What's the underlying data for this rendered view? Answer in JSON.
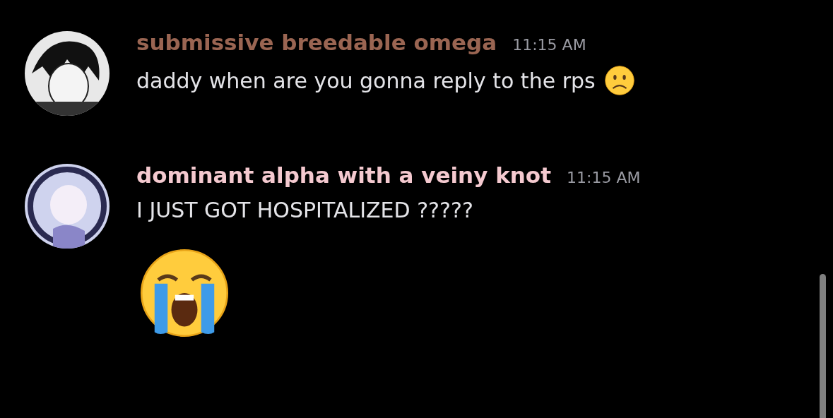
{
  "messages": [
    {
      "username": "submissive breedable omega",
      "color": "#9a6552",
      "timestamp": "11:15 AM",
      "text": "daddy when are you gonna reply to the rps",
      "inline_emoji": {
        "kind": "frowning"
      }
    },
    {
      "username": "dominant alpha with a veiny knot",
      "color": "#f4c9cf",
      "timestamp": "11:15 AM",
      "text": "I JUST GOT HOSPITALIZED ?????",
      "jumbo_emoji": {
        "kind": "crying"
      }
    }
  ]
}
